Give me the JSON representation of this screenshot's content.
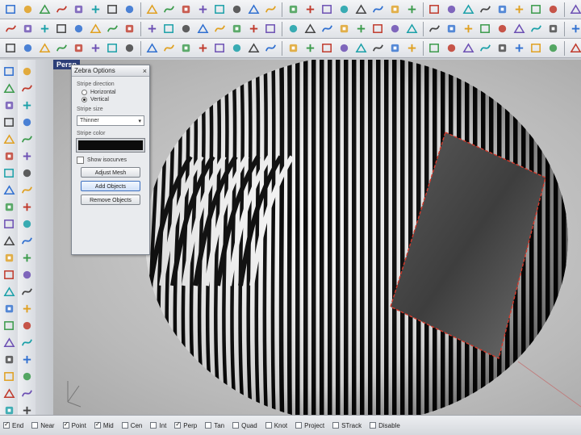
{
  "toolbar_rows": [
    {
      "name": "toolbar-standard",
      "icons": [
        "new-icon",
        "open-icon",
        "save-icon",
        "print-icon",
        "import-icon",
        "cut-icon",
        "copy-icon",
        "paste-icon",
        "undo-icon",
        "redo-icon",
        "pan-icon",
        "rotate-view-icon",
        "zoom-icon",
        "zoom-window-icon",
        "zoom-extents-icon",
        "zoom-selected-icon",
        "four-view-icon",
        "properties-icon",
        "layer-icon",
        "render-icon",
        "light-icon",
        "material-icon",
        "options-icon",
        "help-icon",
        "point-icon",
        "polyline-icon",
        "curve-icon",
        "circle-icon",
        "arc-icon",
        "ellipse-icon",
        "rectangle-icon",
        "polygon-icon",
        "text-icon",
        "hide-icon",
        "show-icon",
        "lock-icon",
        "unlock-icon",
        "group-icon"
      ]
    },
    {
      "name": "toolbar-curve-tools",
      "icons": [
        "fillet-curve-icon",
        "chamfer-curve-icon",
        "blend-curve-icon",
        "offset-curve-icon",
        "extend-curve-icon",
        "trim-icon",
        "split-icon",
        "join-icon",
        "explode-icon",
        "rebuild-icon",
        "fair-icon",
        "project-icon",
        "pull-icon",
        "intersect-icon",
        "contour-icon",
        "section-icon",
        "silhouette-icon",
        "dup-edge-icon",
        "dup-border-icon",
        "extract-isocurve-icon",
        "curve-from-two-views-icon",
        "cross-section-icon",
        "helix-icon",
        "spiral-icon",
        "conic-icon",
        "parabola-icon",
        "hyperbola-icon",
        "freeform-icon",
        "interpolate-icon",
        "sketch-icon",
        "control-points-icon",
        "edit-points-icon",
        "insert-knot-icon",
        "remove-knot-icon",
        "change-degree-icon",
        "match-curve-icon",
        "symmetry-icon",
        "adjust-seam-icon"
      ]
    },
    {
      "name": "toolbar-surface-tools",
      "icons": [
        "plane-icon",
        "sphere-icon",
        "cylinder-icon",
        "cone-icon",
        "box-icon",
        "torus-icon",
        "ellipsoid-icon",
        "paraboloid-icon",
        "tube-icon",
        "pipe-icon",
        "extrude-icon",
        "loft-icon",
        "sweep1-icon",
        "sweep2-icon",
        "revolve-icon",
        "rail-revolve-icon",
        "network-icon",
        "patch-icon",
        "edge-surface-icon",
        "planar-surface-icon",
        "offset-surface-icon",
        "fillet-surface-icon",
        "blend-surface-icon",
        "match-surface-icon",
        "untrim-icon",
        "shrink-icon",
        "split-surface-icon",
        "boolean-union-icon",
        "boolean-difference-icon",
        "boolean-intersection-icon",
        "cap-icon",
        "shell-icon",
        "unroll-icon",
        "flow-icon",
        "cage-icon",
        "twist-icon",
        "bend-icon",
        "taper-icon"
      ]
    }
  ],
  "left_toolbar_a": [
    "line-icon",
    "polyline-icon",
    "rectangle-icon",
    "circle-icon",
    "surface-icon",
    "sphere-icon",
    "box-icon",
    "extrude-icon",
    "boolean-icon",
    "array-icon",
    "mirror-icon",
    "transform-icon",
    "analyze-icon",
    "curvature-icon",
    "dimension-icon",
    "text-icon",
    "mesh-icon",
    "render-icon",
    "zebra-icon",
    "draft-angle-icon",
    "environment-map-icon",
    "edge-tools-icon",
    "points-icon"
  ],
  "left_toolbar_b": [
    "curve-tools-icon",
    "dot-icon",
    "edit-icon",
    "fillet-icon",
    "chamfer-icon",
    "trim-icon",
    "split-icon",
    "join-icon",
    "explode-icon",
    "rebuild-icon",
    "fillet-edges-icon",
    "offset-icon",
    "loft-icon",
    "sweep-icon",
    "revolve-icon",
    "blend-icon",
    "move-icon",
    "copy-icon",
    "rotate-icon",
    "scale-icon",
    "align-icon",
    "orient-icon",
    "project-icon"
  ],
  "viewport": {
    "tab_label": "Persp"
  },
  "zebra_dialog": {
    "title": "Zebra Options",
    "close_glyph": "×",
    "stripe_direction_label": "Stripe direction",
    "options_direction": [
      {
        "label": "Horizontal",
        "selected": false
      },
      {
        "label": "Vertical",
        "selected": true
      }
    ],
    "stripe_size_label": "Stripe size",
    "stripe_size_value": "Thinner",
    "stripe_color_label": "Stripe color",
    "stripe_color": "#0c0c0c",
    "show_isocurves_label": "Show isocurves",
    "show_isocurves_checked": false,
    "adjust_mesh_label": "Adjust Mesh",
    "add_objects_label": "Add Objects",
    "remove_objects_label": "Remove Objects"
  },
  "osnap_bar": [
    {
      "label": "End",
      "checked": true
    },
    {
      "label": "Near",
      "checked": false
    },
    {
      "label": "Point",
      "checked": true
    },
    {
      "label": "Mid",
      "checked": true
    },
    {
      "label": "Cen",
      "checked": false
    },
    {
      "label": "Int",
      "checked": false
    },
    {
      "label": "Perp",
      "checked": true
    },
    {
      "label": "Tan",
      "checked": false
    },
    {
      "label": "Quad",
      "checked": false
    },
    {
      "label": "Knot",
      "checked": false
    },
    {
      "label": "Project",
      "checked": false
    },
    {
      "label": "STrack",
      "checked": false
    },
    {
      "label": "Disable",
      "checked": false
    }
  ],
  "colors": {
    "selection_outline": "#d33a2c",
    "stripe_dark": "#0a0a0a",
    "stripe_light": "#f2f2f2",
    "viewport_bg": "#c0c0c0"
  }
}
